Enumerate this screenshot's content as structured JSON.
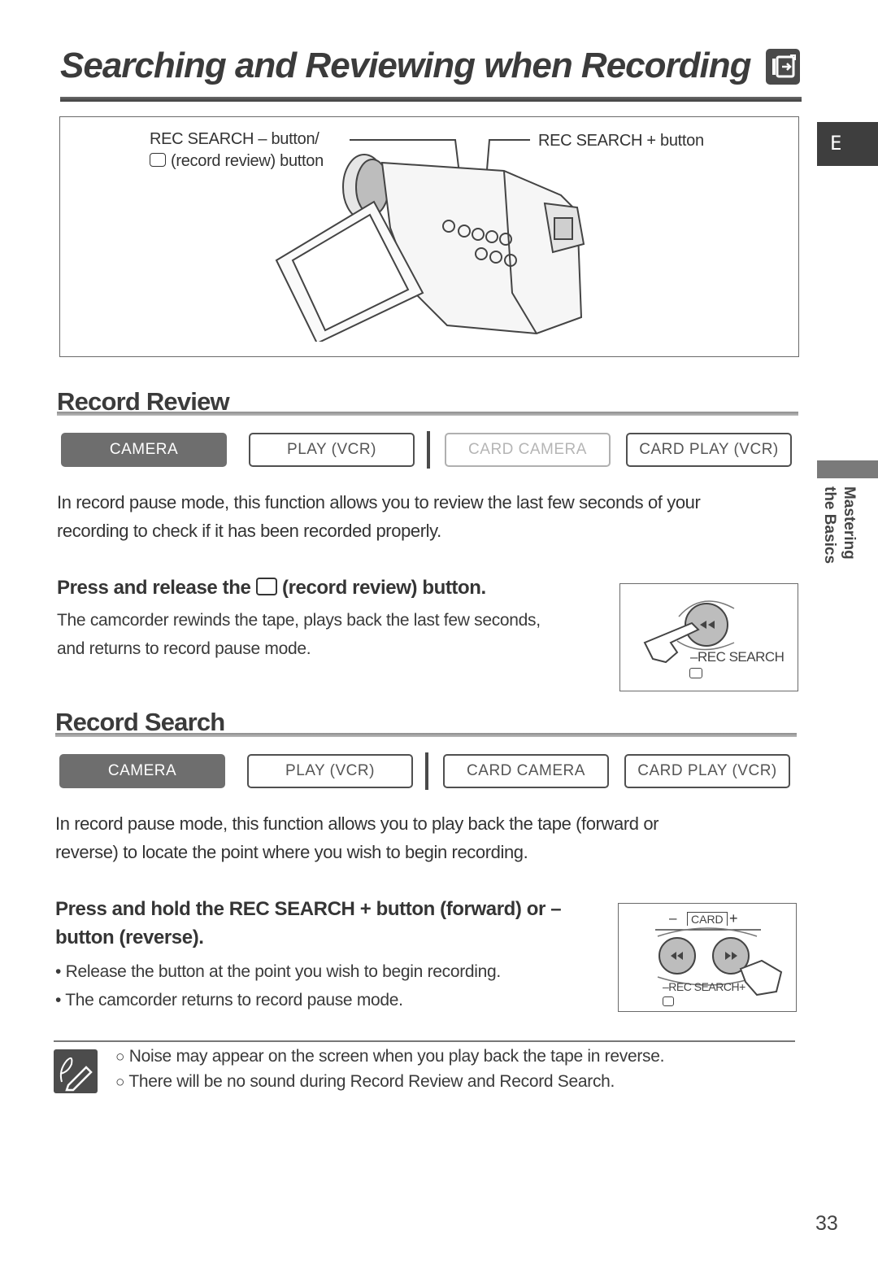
{
  "header": {
    "title": "Searching and Reviewing when Recording",
    "mode_icon": "camera-mode-icon"
  },
  "side_tabs": {
    "language": "E",
    "chapter_line1": "Mastering",
    "chapter_line2": "the Basics"
  },
  "figure": {
    "callout_minus_line1": "REC SEARCH – button/",
    "callout_minus_line2": "(record review) button",
    "callout_plus": "REC SEARCH + button"
  },
  "sections": [
    {
      "heading": "Record Review",
      "modes": [
        {
          "label": "CAMERA",
          "state": "active"
        },
        {
          "label": "PLAY (VCR)",
          "state": "inactive"
        },
        {
          "label": "CARD CAMERA",
          "state": "disabled"
        },
        {
          "label": "CARD PLAY (VCR)",
          "state": "inactive"
        }
      ],
      "description_line1": "In record pause mode, this function allows you to review the last few seconds of your",
      "description_line2": "recording to check if it has been recorded properly.",
      "step_heading_pre": "Press and release the",
      "step_heading_post": "(record review) button.",
      "step_text_line1": "The camcorder rewinds the tape, plays back the last few seconds,",
      "step_text_line2": "and returns to record pause mode.",
      "illustration_label": "REC SEARCH",
      "illustration_minus": "–"
    },
    {
      "heading": "Record Search",
      "modes": [
        {
          "label": "CAMERA",
          "state": "active"
        },
        {
          "label": "PLAY (VCR)",
          "state": "inactive"
        },
        {
          "label": "CARD CAMERA",
          "state": "inactive"
        },
        {
          "label": "CARD PLAY (VCR)",
          "state": "inactive"
        }
      ],
      "description_line1": "In record pause mode, this function allows you to play back the tape (forward or",
      "description_line2": "reverse) to locate the point where you wish to begin recording.",
      "step_heading_line1": "Press and hold the REC SEARCH + button (forward) or –",
      "step_heading_line2": "button (reverse).",
      "bullets": [
        "Release the button at the point you wish to begin recording.",
        "The camcorder returns to record pause mode."
      ],
      "illustration_card": "CARD",
      "illustration_minus": "–",
      "illustration_plus": "+",
      "illustration_label": "REC SEARCH"
    }
  ],
  "notes": [
    "Noise may appear on the screen when you play back the tape in reverse.",
    "There will be no sound during Record Review and Record Search."
  ],
  "note_marker": "❑",
  "page_number": "33"
}
